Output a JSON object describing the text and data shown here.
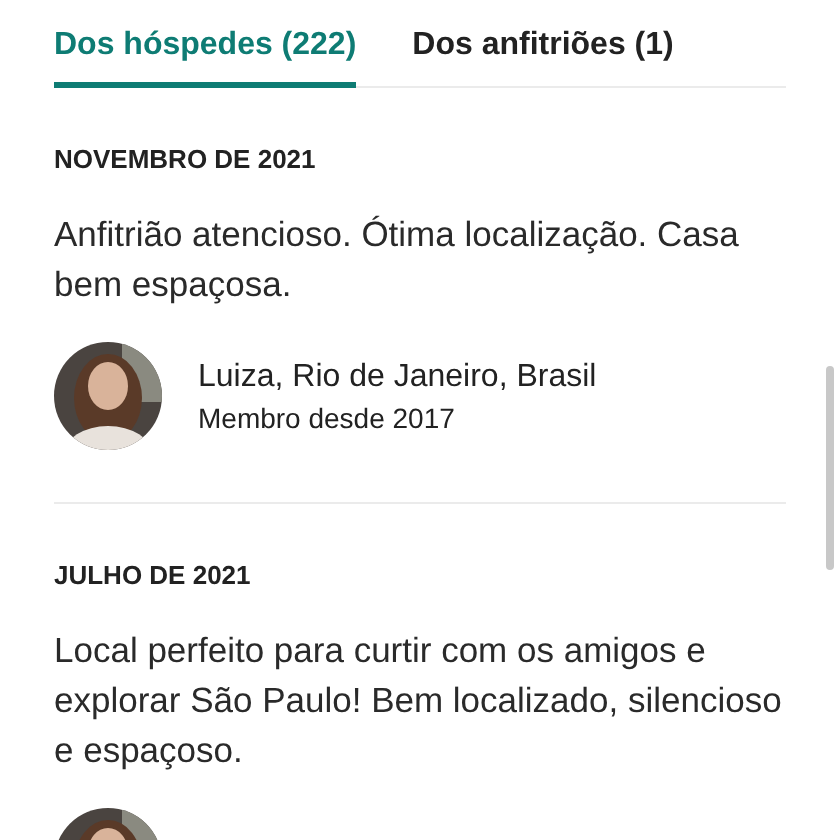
{
  "tabs": [
    {
      "label": "Dos hóspedes (222)",
      "selected": true
    },
    {
      "label": "Dos anfitriões (1)",
      "selected": false
    }
  ],
  "reviews": [
    {
      "date": "NOVEMBRO DE 2021",
      "text": "Anfitrião atencioso. Ótima localização. Casa bem espaçosa.",
      "author": {
        "name": "Luiza, Rio de Janeiro, Brasil",
        "since": "Membro desde 2017"
      }
    },
    {
      "date": "JULHO DE 2021",
      "text": "Local perfeito para curtir com os amigos e explorar São Paulo! Bem localizado, silencioso e espaçoso."
    }
  ]
}
